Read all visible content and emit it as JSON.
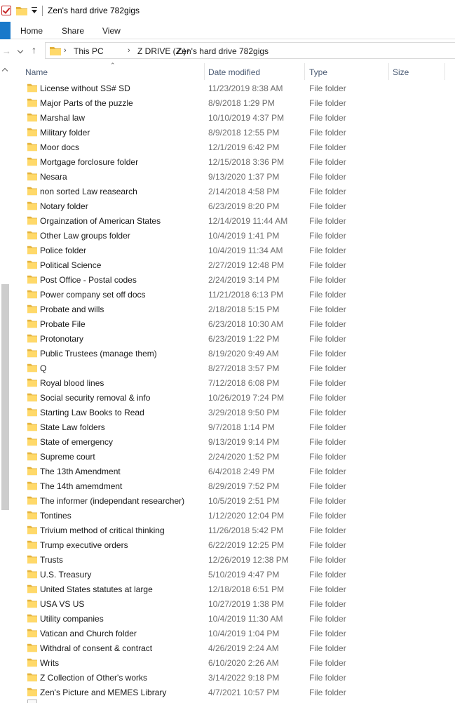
{
  "window": {
    "title": "Zen's hard drive 782gigs"
  },
  "ribbon": {
    "tabs": [
      "Home",
      "Share",
      "View"
    ]
  },
  "address": {
    "crumbs": [
      "This PC",
      "Z DRIVE (Z:)",
      "Zen's hard drive 782gigs"
    ]
  },
  "columns": {
    "name": "Name",
    "date": "Date modified",
    "type": "Type",
    "size": "Size"
  },
  "colors": {
    "folder_fill": "#ffd96a",
    "folder_back": "#e3b23c",
    "accent": "#1979ca",
    "header_text": "#4b5b74"
  },
  "items": [
    {
      "name": "License without SS# SD",
      "date": "11/23/2019 8:38 AM",
      "type": "File folder",
      "size": ""
    },
    {
      "name": "Major Parts of the puzzle",
      "date": "8/9/2018 1:29 PM",
      "type": "File folder",
      "size": ""
    },
    {
      "name": "Marshal law",
      "date": "10/10/2019 4:37 PM",
      "type": "File folder",
      "size": ""
    },
    {
      "name": "Military folder",
      "date": "8/9/2018 12:55 PM",
      "type": "File folder",
      "size": ""
    },
    {
      "name": "Moor docs",
      "date": "12/1/2019 6:42 PM",
      "type": "File folder",
      "size": ""
    },
    {
      "name": "Mortgage forclosure folder",
      "date": "12/15/2018 3:36 PM",
      "type": "File folder",
      "size": ""
    },
    {
      "name": "Nesara",
      "date": "9/13/2020 1:37 PM",
      "type": "File folder",
      "size": ""
    },
    {
      "name": "non sorted Law reasearch",
      "date": "2/14/2018 4:58 PM",
      "type": "File folder",
      "size": ""
    },
    {
      "name": "Notary folder",
      "date": "6/23/2019 8:20 PM",
      "type": "File folder",
      "size": ""
    },
    {
      "name": "Orgainzation of American States",
      "date": "12/14/2019 11:44 AM",
      "type": "File folder",
      "size": ""
    },
    {
      "name": "Other Law groups folder",
      "date": "10/4/2019 1:41 PM",
      "type": "File folder",
      "size": ""
    },
    {
      "name": "Police folder",
      "date": "10/4/2019 11:34 AM",
      "type": "File folder",
      "size": ""
    },
    {
      "name": "Political Science",
      "date": "2/27/2019 12:48 PM",
      "type": "File folder",
      "size": ""
    },
    {
      "name": "Post Office - Postal codes",
      "date": "2/24/2019 3:14 PM",
      "type": "File folder",
      "size": ""
    },
    {
      "name": "Power company set off docs",
      "date": "11/21/2018 6:13 PM",
      "type": "File folder",
      "size": ""
    },
    {
      "name": "Probate and wills",
      "date": "2/18/2018 5:15 PM",
      "type": "File folder",
      "size": ""
    },
    {
      "name": "Probate File",
      "date": "6/23/2018 10:30 AM",
      "type": "File folder",
      "size": ""
    },
    {
      "name": "Protonotary",
      "date": "6/23/2019 1:22 PM",
      "type": "File folder",
      "size": ""
    },
    {
      "name": "Public Trustees (manage them)",
      "date": "8/19/2020 9:49 AM",
      "type": "File folder",
      "size": ""
    },
    {
      "name": "Q",
      "date": "8/27/2018 3:57 PM",
      "type": "File folder",
      "size": ""
    },
    {
      "name": "Royal blood lines",
      "date": "7/12/2018 6:08 PM",
      "type": "File folder",
      "size": ""
    },
    {
      "name": "Social security removal & info",
      "date": "10/26/2019 7:24 PM",
      "type": "File folder",
      "size": ""
    },
    {
      "name": "Starting Law Books to Read",
      "date": "3/29/2018 9:50 PM",
      "type": "File folder",
      "size": ""
    },
    {
      "name": "State Law folders",
      "date": "9/7/2018 1:14 PM",
      "type": "File folder",
      "size": ""
    },
    {
      "name": "State of emergency",
      "date": "9/13/2019 9:14 PM",
      "type": "File folder",
      "size": ""
    },
    {
      "name": "Supreme court",
      "date": "2/24/2020 1:52 PM",
      "type": "File folder",
      "size": ""
    },
    {
      "name": "The 13th Amendment",
      "date": "6/4/2018 2:49 PM",
      "type": "File folder",
      "size": ""
    },
    {
      "name": "The 14th amemdment",
      "date": "8/29/2019 7:52 PM",
      "type": "File folder",
      "size": ""
    },
    {
      "name": "The informer (independant researcher)",
      "date": "10/5/2019 2:51 PM",
      "type": "File folder",
      "size": ""
    },
    {
      "name": "Tontines",
      "date": "1/12/2020 12:04 PM",
      "type": "File folder",
      "size": ""
    },
    {
      "name": "Trivium method of critical thinking",
      "date": "11/26/2018 5:42 PM",
      "type": "File folder",
      "size": ""
    },
    {
      "name": "Trump executive orders",
      "date": "6/22/2019 12:25 PM",
      "type": "File folder",
      "size": ""
    },
    {
      "name": "Trusts",
      "date": "12/26/2019 12:38 PM",
      "type": "File folder",
      "size": ""
    },
    {
      "name": "U.S. Treasury",
      "date": "5/10/2019 4:47 PM",
      "type": "File folder",
      "size": ""
    },
    {
      "name": "United States statutes at large",
      "date": "12/18/2018 6:51 PM",
      "type": "File folder",
      "size": ""
    },
    {
      "name": "USA VS US",
      "date": "10/27/2019 1:38 PM",
      "type": "File folder",
      "size": ""
    },
    {
      "name": "Utility companies",
      "date": "10/4/2019 11:30 AM",
      "type": "File folder",
      "size": ""
    },
    {
      "name": "Vatican and Church folder",
      "date": "10/4/2019 1:04 PM",
      "type": "File folder",
      "size": ""
    },
    {
      "name": "Withdral of consent & contract",
      "date": "4/26/2019 2:24 AM",
      "type": "File folder",
      "size": ""
    },
    {
      "name": "Writs",
      "date": "6/10/2020 2:26 AM",
      "type": "File folder",
      "size": ""
    },
    {
      "name": "Z Collection of Other's works",
      "date": "3/14/2022 9:18 PM",
      "type": "File folder",
      "size": ""
    },
    {
      "name": "Zen's Picture and MEMES Library",
      "date": "4/7/2021 10:57 PM",
      "type": "File folder",
      "size": ""
    }
  ]
}
